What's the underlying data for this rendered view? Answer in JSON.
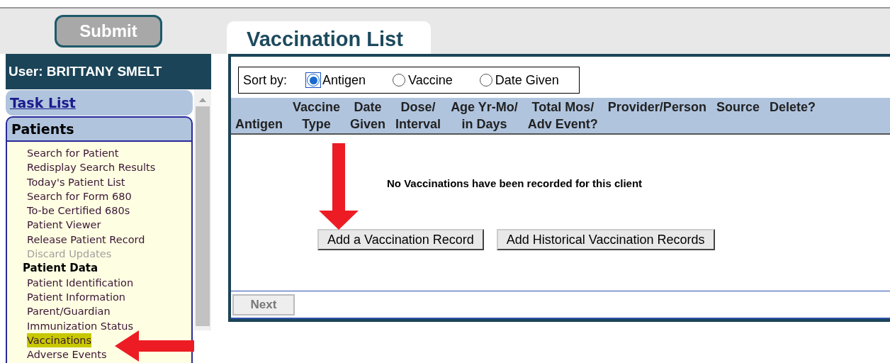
{
  "submit_button": "Submit",
  "tab": {
    "label": "Vaccination List",
    "selected": true
  },
  "user": "User: BRITTANY SMELT",
  "sidebar": {
    "sections": [
      {
        "label": "Task List",
        "kind": "link",
        "expanded": false
      },
      {
        "label": "Patients",
        "kind": "group",
        "expanded": true
      }
    ],
    "items": [
      {
        "label": "Search for Patient",
        "kind": "link",
        "disabled": false,
        "selected": false
      },
      {
        "label": "Redisplay Search Results",
        "kind": "link",
        "disabled": false,
        "selected": false
      },
      {
        "label": "Today's Patient List",
        "kind": "link",
        "disabled": false,
        "selected": false
      },
      {
        "label": "Search for Form 680",
        "kind": "link",
        "disabled": false,
        "selected": false
      },
      {
        "label": "To-be Certified 680s",
        "kind": "link",
        "disabled": false,
        "selected": false
      },
      {
        "label": "Patient Viewer",
        "kind": "link",
        "disabled": false,
        "selected": false
      },
      {
        "label": "Release Patient Record",
        "kind": "link",
        "disabled": false,
        "selected": false
      },
      {
        "label": "Discard Updates",
        "kind": "link",
        "disabled": true,
        "selected": false
      },
      {
        "label": "Patient Data",
        "kind": "heading"
      },
      {
        "label": "Patient Identification",
        "kind": "link",
        "disabled": false,
        "selected": false
      },
      {
        "label": "Patient Information",
        "kind": "link",
        "disabled": false,
        "selected": false
      },
      {
        "label": "Parent/Guardian",
        "kind": "link",
        "disabled": false,
        "selected": false
      },
      {
        "label": "Immunization Status",
        "kind": "link",
        "disabled": false,
        "selected": false
      },
      {
        "label": "Vaccinations",
        "kind": "link",
        "disabled": false,
        "selected": true
      },
      {
        "label": "Adverse Events",
        "kind": "link",
        "disabled": false,
        "selected": false
      }
    ]
  },
  "sort": {
    "label": "Sort by:",
    "options": [
      {
        "label": "Antigen",
        "selected": true
      },
      {
        "label": "Vaccine",
        "selected": false
      },
      {
        "label": "Date Given",
        "selected": false
      }
    ]
  },
  "table": {
    "columns": [
      {
        "lines": [
          "Antigen"
        ]
      },
      {
        "lines": [
          "Vaccine",
          "Type"
        ]
      },
      {
        "lines": [
          "Date",
          "Given"
        ]
      },
      {
        "lines": [
          "Dose/",
          "Interval"
        ]
      },
      {
        "lines": [
          "Age Yr-Mo/",
          "in Days"
        ]
      },
      {
        "lines": [
          "Total Mos/",
          "Adv Event?"
        ]
      },
      {
        "lines": [
          "Provider/Person"
        ]
      },
      {
        "lines": [
          "Source"
        ]
      },
      {
        "lines": [
          "Delete?"
        ]
      }
    ],
    "empty_message": "No Vaccinations have been recorded for this client"
  },
  "buttons": [
    "Add a Vaccination Record",
    "Add Historical Vaccination Records"
  ],
  "next_button": {
    "label": "Next",
    "disabled": true
  }
}
